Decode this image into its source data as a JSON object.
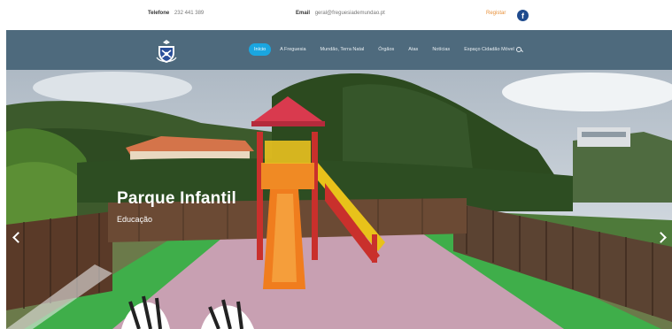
{
  "topbar": {
    "phone_label": "Telefone",
    "phone_value": "232 441 389",
    "email_label": "Email",
    "email_value": "geral@freguesiademundao.pt",
    "register_label": "Registar",
    "facebook_icon": "facebook-icon",
    "facebook_glyph": "f"
  },
  "navbar": {
    "logo_icon": "crest-logo",
    "items": [
      "Início",
      "A Freguesia",
      "Mundão, Terra Natal",
      "Órgãos",
      "Atas",
      "Notícias",
      "Espaço Cidadão Móvel"
    ],
    "search_icon": "search-icon"
  },
  "slider": {
    "title": "Parque Infantil",
    "subtitle": "Educação",
    "prev_icon": "chevron-left-icon",
    "next_icon": "chevron-right-icon"
  },
  "colors": {
    "navbar": "#4e6a7d",
    "active_item": "#1aa6e0",
    "register": "#e8913a",
    "facebook": "#1f4b8e"
  }
}
